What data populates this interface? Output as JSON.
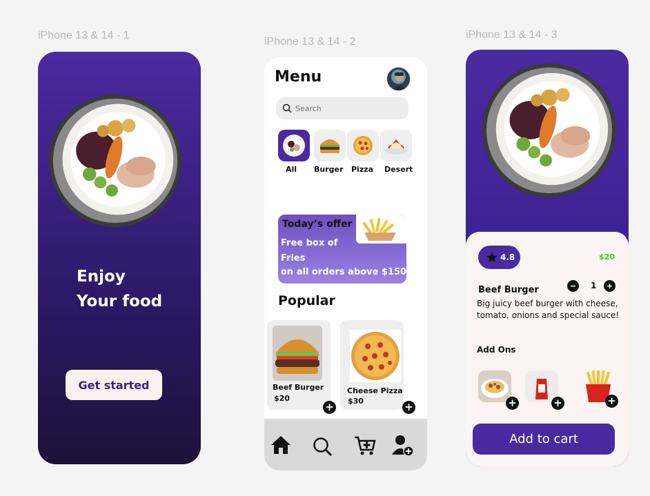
{
  "frames": {
    "frame1_label": "iPhone 13 & 14 - 1",
    "frame2_label": "iPhone 13 & 14 - 2",
    "frame3_label": "iPhone 13 & 14 - 3"
  },
  "colors": {
    "primary": "#4a2aa0",
    "accent_green": "#2cd12c",
    "cream": "#fbf4f2"
  },
  "welcome": {
    "line1": "Enjoy",
    "line2": "Your food",
    "cta": "Get started"
  },
  "menu": {
    "title": "Menu",
    "search_placeholder": "Search",
    "categories": [
      {
        "label": "All",
        "icon": "plate-icon"
      },
      {
        "label": "Burger",
        "icon": "burger-icon"
      },
      {
        "label": "Pizza",
        "icon": "pizza-icon"
      },
      {
        "label": "Desert",
        "icon": "cake-icon"
      }
    ],
    "offer": {
      "heading": "Today’s offer",
      "line1": "Free box of",
      "line2": "Fries",
      "line3": "on all orders above $150"
    },
    "popular_title": "Popular",
    "popular": [
      {
        "name": "Beef Burger",
        "price": "$20"
      },
      {
        "name": "Cheese Pizza",
        "price": "$30"
      }
    ],
    "nav": [
      "home-icon",
      "search-icon",
      "cart-icon",
      "add-user-icon"
    ]
  },
  "detail": {
    "rating": "4.8",
    "price": "$20",
    "name": "Beef Burger",
    "quantity": "1",
    "description": "Big juicy beef burger with cheese, tomato, onions and special sauce!",
    "addons_title": "Add Ons",
    "addons": [
      "pasta-icon",
      "ketchup-icon",
      "fries-icon"
    ],
    "cta": "Add to cart"
  }
}
